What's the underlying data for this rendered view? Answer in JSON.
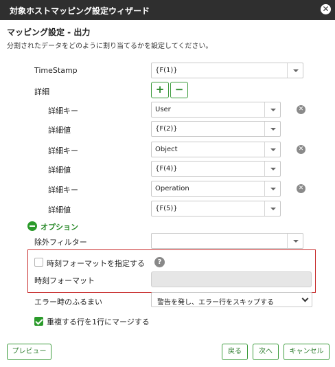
{
  "dialog": {
    "title": "対象ホストマッピング設定ウィザード",
    "close_glyph": "✕",
    "heading": "マッピング設定 - 出力",
    "description": "分割されたデータをどのように割り当てるかを設定してください。"
  },
  "fields": {
    "timestamp_label": "TimeStamp",
    "timestamp_value": "{F(1)}",
    "detail_label": "詳細",
    "add_label": "+",
    "remove_label": "−",
    "details": [
      {
        "key_label": "詳細キー",
        "key_value": "User",
        "val_label": "詳細値",
        "val_value": "{F(2)}"
      },
      {
        "key_label": "詳細キー",
        "key_value": "Object",
        "val_label": "詳細値",
        "val_value": "{F(4)}"
      },
      {
        "key_label": "詳細キー",
        "key_value": "Operation",
        "val_label": "詳細値",
        "val_value": "{F(5)}"
      }
    ],
    "delete_glyph": "✕"
  },
  "options": {
    "label": "オプション",
    "exclude_filter_label": "除外フィルター",
    "exclude_filter_value": "",
    "time_format_checkbox_label": "時刻フォーマットを指定する",
    "time_format_checked": false,
    "help_glyph": "?",
    "time_format_label": "時刻フォーマット",
    "time_format_value": "",
    "error_behavior_label": "エラー時のふるまい",
    "error_behavior_value": "警告を発し、エラー行をスキップする",
    "merge_label": "重複する行を1行にマージする",
    "merge_checked": true
  },
  "footer": {
    "preview": "プレビュー",
    "back": "戻る",
    "next": "次へ",
    "cancel": "キャンセル"
  },
  "colors": {
    "titlebar": "#2f2f2f",
    "accent_green": "#2a9a2a",
    "highlight_red": "#c62828"
  }
}
